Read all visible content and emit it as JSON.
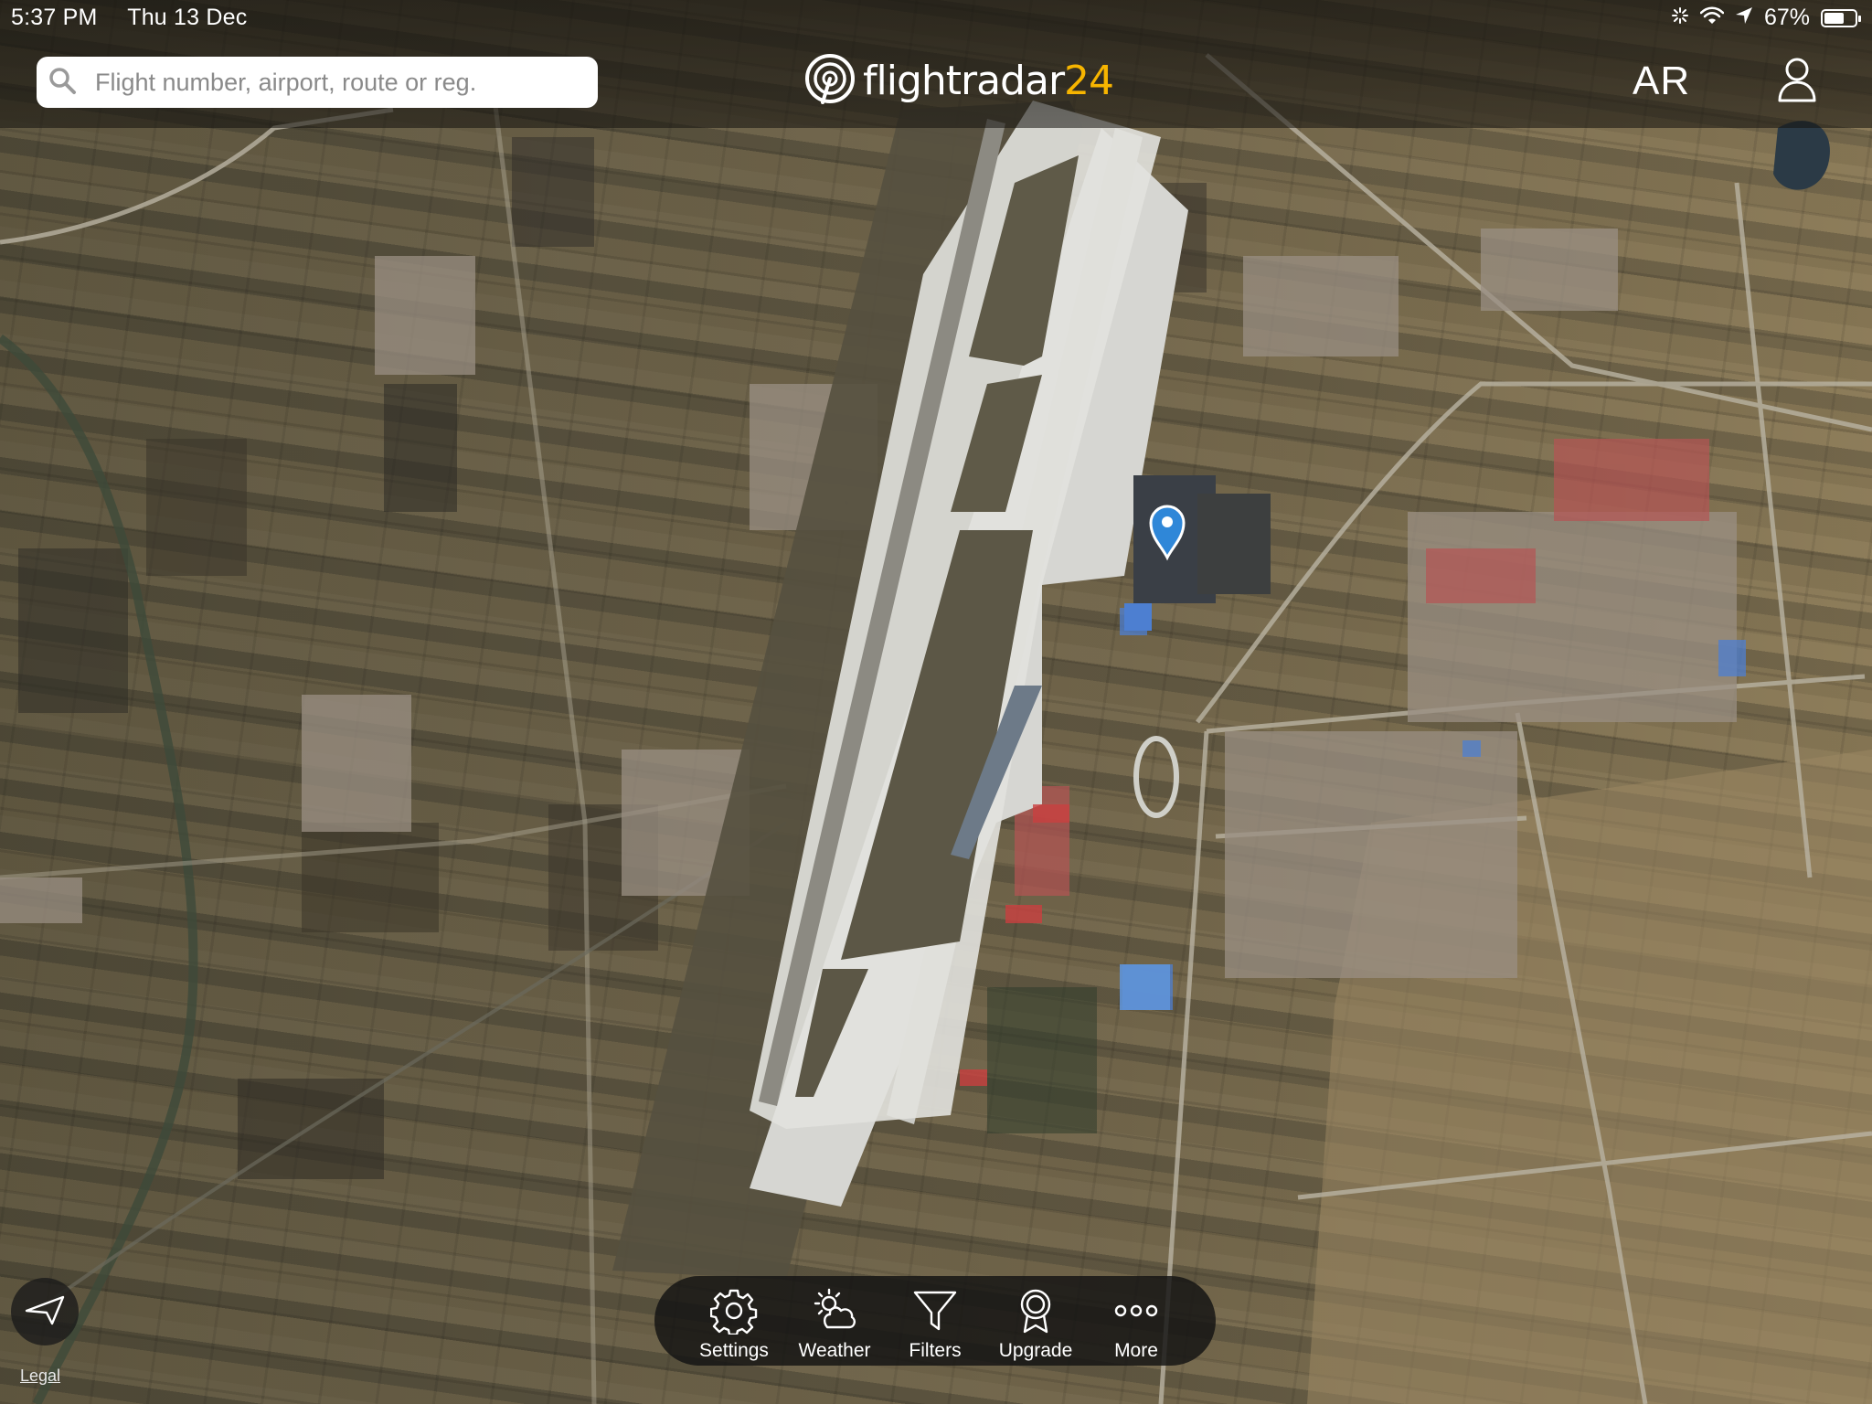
{
  "status_bar": {
    "time": "5:37 PM",
    "date": "Thu 13 Dec",
    "battery": "67%",
    "battery_level": 0.67
  },
  "search": {
    "placeholder": "Flight number, airport, route or reg."
  },
  "logo": {
    "word": "flightradar",
    "number": "24"
  },
  "header": {
    "ar_label": "AR"
  },
  "toolbar": {
    "settings": "Settings",
    "weather": "Weather",
    "filters": "Filters",
    "upgrade": "Upgrade",
    "more": "More"
  },
  "map": {
    "legal": "Legal"
  },
  "icons": {
    "search": "search-icon",
    "user": "user-icon",
    "locate": "location-arrow-icon",
    "settings": "gear-icon",
    "weather": "weather-cloud-sun-icon",
    "filters": "funnel-icon",
    "upgrade": "award-ribbon-icon",
    "more": "three-dots-icon",
    "pin": "map-pin-icon"
  },
  "colors": {
    "brand_accent": "#f7b500",
    "pin": "#2f87d8"
  }
}
